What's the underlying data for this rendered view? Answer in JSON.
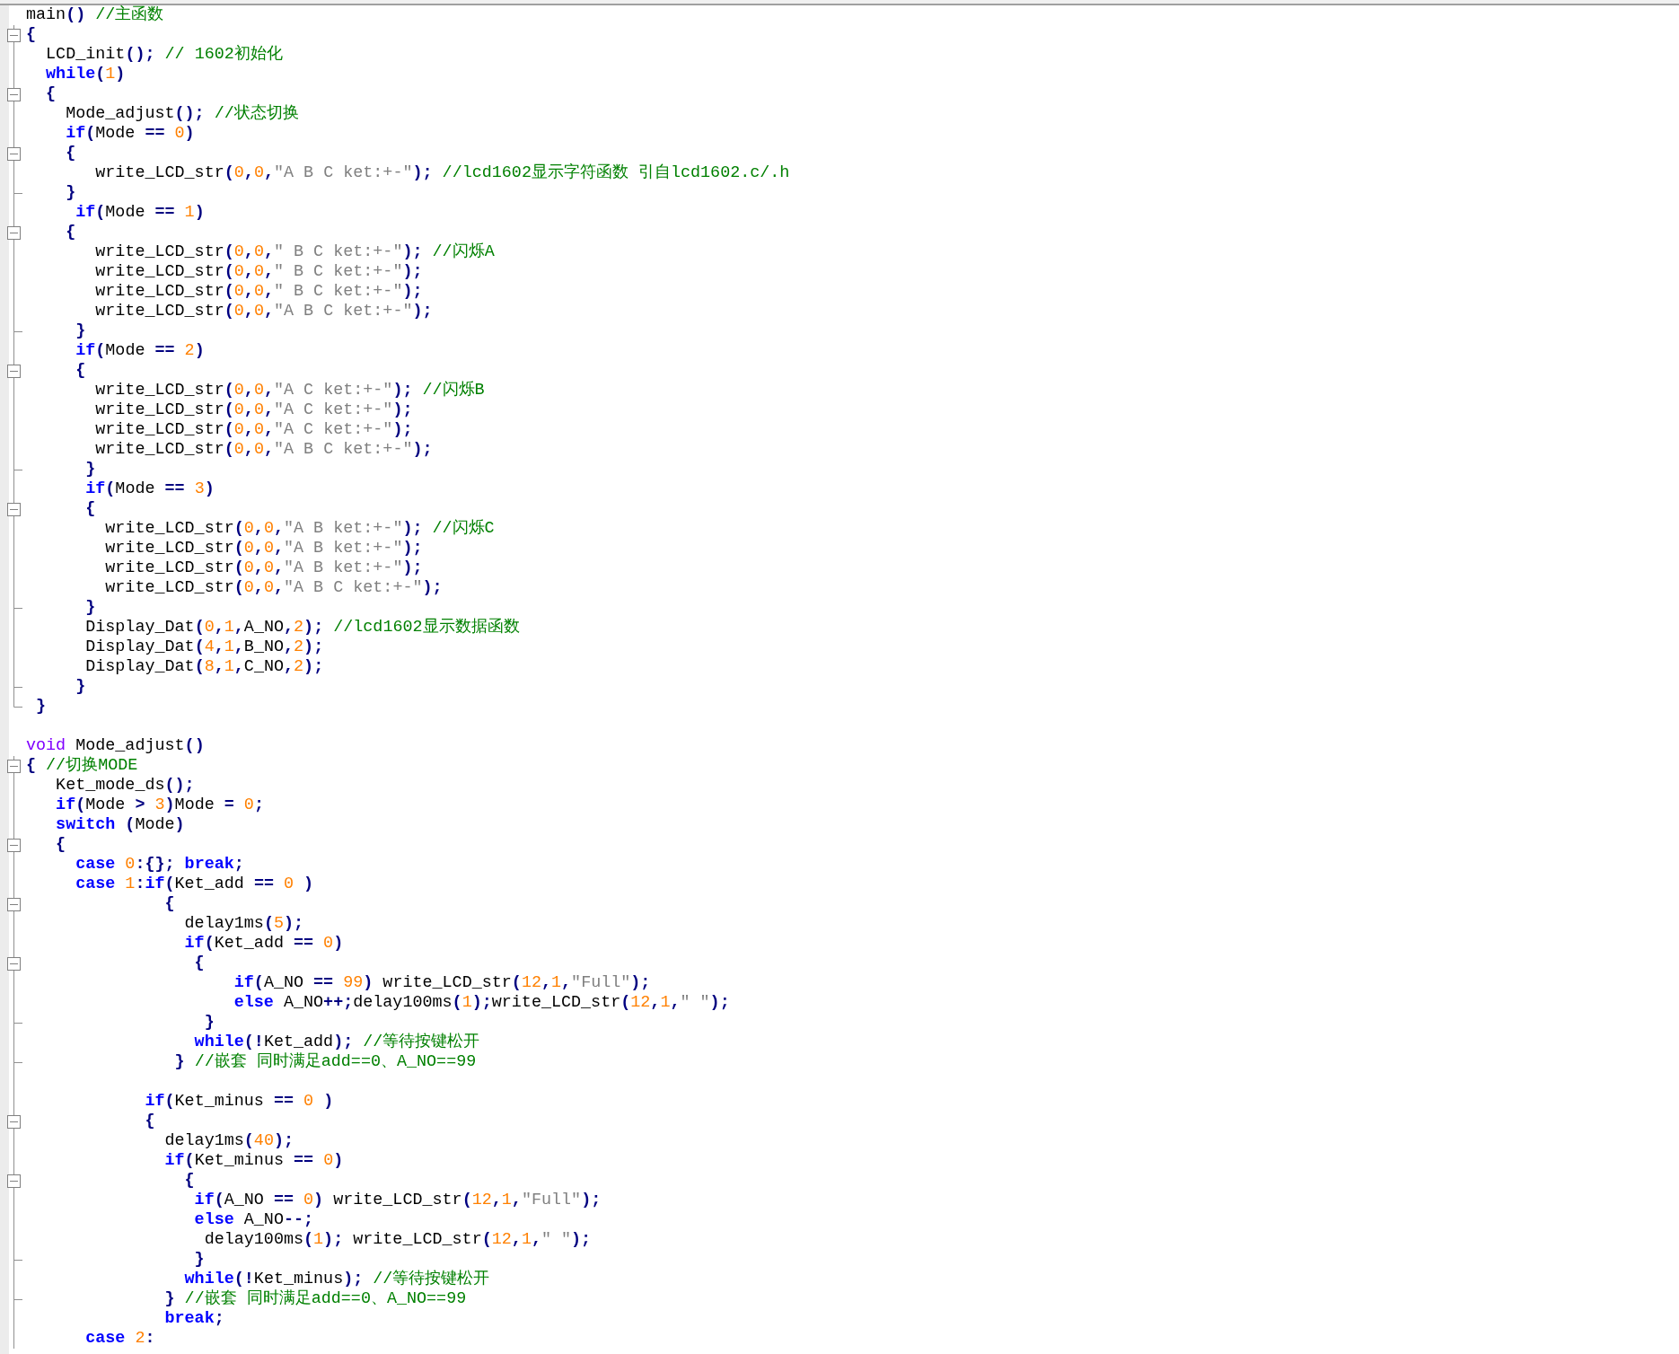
{
  "editor": {
    "lines": [
      {
        "kind": "code",
        "fold_start": false,
        "fold_end": false,
        "in_block": false,
        "tokens": [
          {
            "kind": "id",
            "text": "main"
          },
          {
            "kind": "op",
            "text": "() "
          },
          {
            "kind": "cmt",
            "text": "//主函数"
          }
        ]
      },
      {
        "kind": "code",
        "fold_start": true,
        "fold_end": false,
        "in_block": true,
        "tokens": [
          {
            "kind": "op",
            "text": "{"
          }
        ]
      },
      {
        "kind": "code",
        "fold_start": false,
        "fold_end": false,
        "in_block": true,
        "tokens": [
          {
            "kind": "id",
            "text": "  LCD_init"
          },
          {
            "kind": "op",
            "text": "(); "
          },
          {
            "kind": "cmt",
            "text": "// 1602初始化"
          }
        ]
      },
      {
        "kind": "code",
        "fold_start": false,
        "fold_end": false,
        "in_block": true,
        "tokens": [
          {
            "kind": "kw",
            "text": "  while"
          },
          {
            "kind": "op",
            "text": "("
          },
          {
            "kind": "num",
            "text": "1"
          },
          {
            "kind": "op",
            "text": ")"
          }
        ]
      },
      {
        "kind": "code",
        "fold_start": true,
        "fold_end": false,
        "in_block": true,
        "tokens": [
          {
            "kind": "op",
            "text": "  {"
          }
        ]
      },
      {
        "kind": "code",
        "fold_start": false,
        "fold_end": false,
        "in_block": true,
        "tokens": [
          {
            "kind": "id",
            "text": "    Mode_adjust"
          },
          {
            "kind": "op",
            "text": "(); "
          },
          {
            "kind": "cmt",
            "text": "//状态切换"
          }
        ]
      },
      {
        "kind": "code",
        "fold_start": false,
        "fold_end": false,
        "in_block": true,
        "tokens": [
          {
            "kind": "kw",
            "text": "    if"
          },
          {
            "kind": "op",
            "text": "("
          },
          {
            "kind": "id",
            "text": "Mode "
          },
          {
            "kind": "op",
            "text": "== "
          },
          {
            "kind": "num",
            "text": "0"
          },
          {
            "kind": "op",
            "text": ")"
          }
        ]
      },
      {
        "kind": "code",
        "fold_start": true,
        "fold_end": false,
        "in_block": true,
        "tokens": [
          {
            "kind": "op",
            "text": "    {"
          }
        ]
      },
      {
        "kind": "code",
        "fold_start": false,
        "fold_end": false,
        "in_block": true,
        "tokens": [
          {
            "kind": "id",
            "text": "       write_LCD_str"
          },
          {
            "kind": "op",
            "text": "("
          },
          {
            "kind": "num",
            "text": "0"
          },
          {
            "kind": "op",
            "text": ","
          },
          {
            "kind": "num",
            "text": "0"
          },
          {
            "kind": "op",
            "text": ","
          },
          {
            "kind": "str",
            "text": "\"A B C ket:+-\""
          },
          {
            "kind": "op",
            "text": "); "
          },
          {
            "kind": "cmt",
            "text": "//lcd1602显示字符函数 引自lcd1602.c/.h"
          }
        ]
      },
      {
        "kind": "code",
        "fold_start": false,
        "fold_end": true,
        "in_block": true,
        "tokens": [
          {
            "kind": "op",
            "text": "    }"
          }
        ]
      },
      {
        "kind": "code",
        "fold_start": false,
        "fold_end": false,
        "in_block": true,
        "tokens": [
          {
            "kind": "kw",
            "text": "     if"
          },
          {
            "kind": "op",
            "text": "("
          },
          {
            "kind": "id",
            "text": "Mode "
          },
          {
            "kind": "op",
            "text": "== "
          },
          {
            "kind": "num",
            "text": "1"
          },
          {
            "kind": "op",
            "text": ")"
          }
        ]
      },
      {
        "kind": "code",
        "fold_start": true,
        "fold_end": false,
        "in_block": true,
        "tokens": [
          {
            "kind": "op",
            "text": "    {"
          }
        ]
      },
      {
        "kind": "code",
        "fold_start": false,
        "fold_end": false,
        "in_block": true,
        "tokens": [
          {
            "kind": "id",
            "text": "       write_LCD_str"
          },
          {
            "kind": "op",
            "text": "("
          },
          {
            "kind": "num",
            "text": "0"
          },
          {
            "kind": "op",
            "text": ","
          },
          {
            "kind": "num",
            "text": "0"
          },
          {
            "kind": "op",
            "text": ","
          },
          {
            "kind": "str",
            "text": "\" B C ket:+-\""
          },
          {
            "kind": "op",
            "text": "); "
          },
          {
            "kind": "cmt",
            "text": "//闪烁A"
          }
        ]
      },
      {
        "kind": "code",
        "fold_start": false,
        "fold_end": false,
        "in_block": true,
        "tokens": [
          {
            "kind": "id",
            "text": "       write_LCD_str"
          },
          {
            "kind": "op",
            "text": "("
          },
          {
            "kind": "num",
            "text": "0"
          },
          {
            "kind": "op",
            "text": ","
          },
          {
            "kind": "num",
            "text": "0"
          },
          {
            "kind": "op",
            "text": ","
          },
          {
            "kind": "str",
            "text": "\" B C ket:+-\""
          },
          {
            "kind": "op",
            "text": ");"
          }
        ]
      },
      {
        "kind": "code",
        "fold_start": false,
        "fold_end": false,
        "in_block": true,
        "tokens": [
          {
            "kind": "id",
            "text": "       write_LCD_str"
          },
          {
            "kind": "op",
            "text": "("
          },
          {
            "kind": "num",
            "text": "0"
          },
          {
            "kind": "op",
            "text": ","
          },
          {
            "kind": "num",
            "text": "0"
          },
          {
            "kind": "op",
            "text": ","
          },
          {
            "kind": "str",
            "text": "\" B C ket:+-\""
          },
          {
            "kind": "op",
            "text": ");"
          }
        ]
      },
      {
        "kind": "code",
        "fold_start": false,
        "fold_end": false,
        "in_block": true,
        "tokens": [
          {
            "kind": "id",
            "text": "       write_LCD_str"
          },
          {
            "kind": "op",
            "text": "("
          },
          {
            "kind": "num",
            "text": "0"
          },
          {
            "kind": "op",
            "text": ","
          },
          {
            "kind": "num",
            "text": "0"
          },
          {
            "kind": "op",
            "text": ","
          },
          {
            "kind": "str",
            "text": "\"A B C ket:+-\""
          },
          {
            "kind": "op",
            "text": ");"
          }
        ]
      },
      {
        "kind": "code",
        "fold_start": false,
        "fold_end": true,
        "in_block": true,
        "tokens": [
          {
            "kind": "op",
            "text": "     }"
          }
        ]
      },
      {
        "kind": "code",
        "fold_start": false,
        "fold_end": false,
        "in_block": true,
        "tokens": [
          {
            "kind": "kw",
            "text": "     if"
          },
          {
            "kind": "op",
            "text": "("
          },
          {
            "kind": "id",
            "text": "Mode "
          },
          {
            "kind": "op",
            "text": "== "
          },
          {
            "kind": "num",
            "text": "2"
          },
          {
            "kind": "op",
            "text": ")"
          }
        ]
      },
      {
        "kind": "code",
        "fold_start": true,
        "fold_end": false,
        "in_block": true,
        "tokens": [
          {
            "kind": "op",
            "text": "     {"
          }
        ]
      },
      {
        "kind": "code",
        "fold_start": false,
        "fold_end": false,
        "in_block": true,
        "tokens": [
          {
            "kind": "id",
            "text": "       write_LCD_str"
          },
          {
            "kind": "op",
            "text": "("
          },
          {
            "kind": "num",
            "text": "0"
          },
          {
            "kind": "op",
            "text": ","
          },
          {
            "kind": "num",
            "text": "0"
          },
          {
            "kind": "op",
            "text": ","
          },
          {
            "kind": "str",
            "text": "\"A C ket:+-\""
          },
          {
            "kind": "op",
            "text": "); "
          },
          {
            "kind": "cmt",
            "text": "//闪烁B"
          }
        ]
      },
      {
        "kind": "code",
        "fold_start": false,
        "fold_end": false,
        "in_block": true,
        "tokens": [
          {
            "kind": "id",
            "text": "       write_LCD_str"
          },
          {
            "kind": "op",
            "text": "("
          },
          {
            "kind": "num",
            "text": "0"
          },
          {
            "kind": "op",
            "text": ","
          },
          {
            "kind": "num",
            "text": "0"
          },
          {
            "kind": "op",
            "text": ","
          },
          {
            "kind": "str",
            "text": "\"A C ket:+-\""
          },
          {
            "kind": "op",
            "text": ");"
          }
        ]
      },
      {
        "kind": "code",
        "fold_start": false,
        "fold_end": false,
        "in_block": true,
        "tokens": [
          {
            "kind": "id",
            "text": "       write_LCD_str"
          },
          {
            "kind": "op",
            "text": "("
          },
          {
            "kind": "num",
            "text": "0"
          },
          {
            "kind": "op",
            "text": ","
          },
          {
            "kind": "num",
            "text": "0"
          },
          {
            "kind": "op",
            "text": ","
          },
          {
            "kind": "str",
            "text": "\"A C ket:+-\""
          },
          {
            "kind": "op",
            "text": ");"
          }
        ]
      },
      {
        "kind": "code",
        "fold_start": false,
        "fold_end": false,
        "in_block": true,
        "tokens": [
          {
            "kind": "id",
            "text": "       write_LCD_str"
          },
          {
            "kind": "op",
            "text": "("
          },
          {
            "kind": "num",
            "text": "0"
          },
          {
            "kind": "op",
            "text": ","
          },
          {
            "kind": "num",
            "text": "0"
          },
          {
            "kind": "op",
            "text": ","
          },
          {
            "kind": "str",
            "text": "\"A B C ket:+-\""
          },
          {
            "kind": "op",
            "text": ");"
          }
        ]
      },
      {
        "kind": "code",
        "fold_start": false,
        "fold_end": true,
        "in_block": true,
        "tokens": [
          {
            "kind": "op",
            "text": "      }"
          }
        ]
      },
      {
        "kind": "code",
        "fold_start": false,
        "fold_end": false,
        "in_block": true,
        "tokens": [
          {
            "kind": "kw",
            "text": "      if"
          },
          {
            "kind": "op",
            "text": "("
          },
          {
            "kind": "id",
            "text": "Mode "
          },
          {
            "kind": "op",
            "text": "== "
          },
          {
            "kind": "num",
            "text": "3"
          },
          {
            "kind": "op",
            "text": ")"
          }
        ]
      },
      {
        "kind": "code",
        "fold_start": true,
        "fold_end": false,
        "in_block": true,
        "tokens": [
          {
            "kind": "op",
            "text": "      {"
          }
        ]
      },
      {
        "kind": "code",
        "fold_start": false,
        "fold_end": false,
        "in_block": true,
        "tokens": [
          {
            "kind": "id",
            "text": "        write_LCD_str"
          },
          {
            "kind": "op",
            "text": "("
          },
          {
            "kind": "num",
            "text": "0"
          },
          {
            "kind": "op",
            "text": ","
          },
          {
            "kind": "num",
            "text": "0"
          },
          {
            "kind": "op",
            "text": ","
          },
          {
            "kind": "str",
            "text": "\"A B ket:+-\""
          },
          {
            "kind": "op",
            "text": "); "
          },
          {
            "kind": "cmt",
            "text": "//闪烁C"
          }
        ]
      },
      {
        "kind": "code",
        "fold_start": false,
        "fold_end": false,
        "in_block": true,
        "tokens": [
          {
            "kind": "id",
            "text": "        write_LCD_str"
          },
          {
            "kind": "op",
            "text": "("
          },
          {
            "kind": "num",
            "text": "0"
          },
          {
            "kind": "op",
            "text": ","
          },
          {
            "kind": "num",
            "text": "0"
          },
          {
            "kind": "op",
            "text": ","
          },
          {
            "kind": "str",
            "text": "\"A B ket:+-\""
          },
          {
            "kind": "op",
            "text": ");"
          }
        ]
      },
      {
        "kind": "code",
        "fold_start": false,
        "fold_end": false,
        "in_block": true,
        "tokens": [
          {
            "kind": "id",
            "text": "        write_LCD_str"
          },
          {
            "kind": "op",
            "text": "("
          },
          {
            "kind": "num",
            "text": "0"
          },
          {
            "kind": "op",
            "text": ","
          },
          {
            "kind": "num",
            "text": "0"
          },
          {
            "kind": "op",
            "text": ","
          },
          {
            "kind": "str",
            "text": "\"A B ket:+-\""
          },
          {
            "kind": "op",
            "text": ");"
          }
        ]
      },
      {
        "kind": "code",
        "fold_start": false,
        "fold_end": false,
        "in_block": true,
        "tokens": [
          {
            "kind": "id",
            "text": "        write_LCD_str"
          },
          {
            "kind": "op",
            "text": "("
          },
          {
            "kind": "num",
            "text": "0"
          },
          {
            "kind": "op",
            "text": ","
          },
          {
            "kind": "num",
            "text": "0"
          },
          {
            "kind": "op",
            "text": ","
          },
          {
            "kind": "str",
            "text": "\"A B C ket:+-\""
          },
          {
            "kind": "op",
            "text": ");"
          }
        ]
      },
      {
        "kind": "code",
        "fold_start": false,
        "fold_end": true,
        "in_block": true,
        "tokens": [
          {
            "kind": "op",
            "text": "      }"
          }
        ]
      },
      {
        "kind": "code",
        "fold_start": false,
        "fold_end": false,
        "in_block": true,
        "tokens": [
          {
            "kind": "id",
            "text": "      Display_Dat"
          },
          {
            "kind": "op",
            "text": "("
          },
          {
            "kind": "num",
            "text": "0"
          },
          {
            "kind": "op",
            "text": ","
          },
          {
            "kind": "num",
            "text": "1"
          },
          {
            "kind": "op",
            "text": ","
          },
          {
            "kind": "id",
            "text": "A_NO"
          },
          {
            "kind": "op",
            "text": ","
          },
          {
            "kind": "num",
            "text": "2"
          },
          {
            "kind": "op",
            "text": "); "
          },
          {
            "kind": "cmt",
            "text": "//lcd1602显示数据函数"
          }
        ]
      },
      {
        "kind": "code",
        "fold_start": false,
        "fold_end": false,
        "in_block": true,
        "tokens": [
          {
            "kind": "id",
            "text": "      Display_Dat"
          },
          {
            "kind": "op",
            "text": "("
          },
          {
            "kind": "num",
            "text": "4"
          },
          {
            "kind": "op",
            "text": ","
          },
          {
            "kind": "num",
            "text": "1"
          },
          {
            "kind": "op",
            "text": ","
          },
          {
            "kind": "id",
            "text": "B_NO"
          },
          {
            "kind": "op",
            "text": ","
          },
          {
            "kind": "num",
            "text": "2"
          },
          {
            "kind": "op",
            "text": ");"
          }
        ]
      },
      {
        "kind": "code",
        "fold_start": false,
        "fold_end": false,
        "in_block": true,
        "tokens": [
          {
            "kind": "id",
            "text": "      Display_Dat"
          },
          {
            "kind": "op",
            "text": "("
          },
          {
            "kind": "num",
            "text": "8"
          },
          {
            "kind": "op",
            "text": ","
          },
          {
            "kind": "num",
            "text": "1"
          },
          {
            "kind": "op",
            "text": ","
          },
          {
            "kind": "id",
            "text": "C_NO"
          },
          {
            "kind": "op",
            "text": ","
          },
          {
            "kind": "num",
            "text": "2"
          },
          {
            "kind": "op",
            "text": ");"
          }
        ]
      },
      {
        "kind": "code",
        "fold_start": false,
        "fold_end": true,
        "in_block": true,
        "tokens": [
          {
            "kind": "op",
            "text": "     }"
          }
        ]
      },
      {
        "kind": "code",
        "fold_start": false,
        "fold_end": true,
        "in_block": false,
        "tokens": [
          {
            "kind": "op",
            "text": " }"
          }
        ]
      },
      {
        "kind": "blank",
        "fold_start": false,
        "fold_end": false,
        "in_block": false
      },
      {
        "kind": "code",
        "fold_start": false,
        "fold_end": false,
        "in_block": false,
        "tokens": [
          {
            "kind": "type",
            "text": "void"
          },
          {
            "kind": "id",
            "text": " Mode_adjust"
          },
          {
            "kind": "op",
            "text": "()"
          }
        ]
      },
      {
        "kind": "code",
        "fold_start": true,
        "fold_end": false,
        "in_block": true,
        "tokens": [
          {
            "kind": "op",
            "text": "{ "
          },
          {
            "kind": "cmt",
            "text": "//切换MODE"
          }
        ]
      },
      {
        "kind": "code",
        "fold_start": false,
        "fold_end": false,
        "in_block": true,
        "tokens": [
          {
            "kind": "id",
            "text": "   Ket_mode_ds"
          },
          {
            "kind": "op",
            "text": "();"
          }
        ]
      },
      {
        "kind": "code",
        "fold_start": false,
        "fold_end": false,
        "in_block": true,
        "tokens": [
          {
            "kind": "kw",
            "text": "   if"
          },
          {
            "kind": "op",
            "text": "("
          },
          {
            "kind": "id",
            "text": "Mode "
          },
          {
            "kind": "op",
            "text": "> "
          },
          {
            "kind": "num",
            "text": "3"
          },
          {
            "kind": "op",
            "text": ")"
          },
          {
            "kind": "id",
            "text": "Mode "
          },
          {
            "kind": "op",
            "text": "= "
          },
          {
            "kind": "num",
            "text": "0"
          },
          {
            "kind": "op",
            "text": ";"
          }
        ]
      },
      {
        "kind": "code",
        "fold_start": false,
        "fold_end": false,
        "in_block": true,
        "tokens": [
          {
            "kind": "kw",
            "text": "   switch"
          },
          {
            "kind": "op",
            "text": " ("
          },
          {
            "kind": "id",
            "text": "Mode"
          },
          {
            "kind": "op",
            "text": ")"
          }
        ]
      },
      {
        "kind": "code",
        "fold_start": true,
        "fold_end": false,
        "in_block": true,
        "tokens": [
          {
            "kind": "op",
            "text": "   {"
          }
        ]
      },
      {
        "kind": "code",
        "fold_start": false,
        "fold_end": false,
        "in_block": true,
        "tokens": [
          {
            "kind": "kw",
            "text": "     case"
          },
          {
            "kind": "num",
            "text": " 0"
          },
          {
            "kind": "op",
            "text": ":{}; "
          },
          {
            "kind": "kw",
            "text": "break"
          },
          {
            "kind": "op",
            "text": ";"
          }
        ]
      },
      {
        "kind": "code",
        "fold_start": false,
        "fold_end": false,
        "in_block": true,
        "tokens": [
          {
            "kind": "kw",
            "text": "     case"
          },
          {
            "kind": "num",
            "text": " 1"
          },
          {
            "kind": "op",
            "text": ":"
          },
          {
            "kind": "kw",
            "text": "if"
          },
          {
            "kind": "op",
            "text": "("
          },
          {
            "kind": "id",
            "text": "Ket_add "
          },
          {
            "kind": "op",
            "text": "== "
          },
          {
            "kind": "num",
            "text": "0"
          },
          {
            "kind": "op",
            "text": " )"
          }
        ]
      },
      {
        "kind": "code",
        "fold_start": true,
        "fold_end": false,
        "in_block": true,
        "tokens": [
          {
            "kind": "op",
            "text": "              {"
          }
        ]
      },
      {
        "kind": "code",
        "fold_start": false,
        "fold_end": false,
        "in_block": true,
        "tokens": [
          {
            "kind": "id",
            "text": "                delay1ms"
          },
          {
            "kind": "op",
            "text": "("
          },
          {
            "kind": "num",
            "text": "5"
          },
          {
            "kind": "op",
            "text": ");"
          }
        ]
      },
      {
        "kind": "code",
        "fold_start": false,
        "fold_end": false,
        "in_block": true,
        "tokens": [
          {
            "kind": "kw",
            "text": "                if"
          },
          {
            "kind": "op",
            "text": "("
          },
          {
            "kind": "id",
            "text": "Ket_add "
          },
          {
            "kind": "op",
            "text": "== "
          },
          {
            "kind": "num",
            "text": "0"
          },
          {
            "kind": "op",
            "text": ")"
          }
        ]
      },
      {
        "kind": "code",
        "fold_start": true,
        "fold_end": false,
        "in_block": true,
        "tokens": [
          {
            "kind": "op",
            "text": "                 {"
          }
        ]
      },
      {
        "kind": "code",
        "fold_start": false,
        "fold_end": false,
        "in_block": true,
        "tokens": [
          {
            "kind": "kw",
            "text": "                     if"
          },
          {
            "kind": "op",
            "text": "("
          },
          {
            "kind": "id",
            "text": "A_NO "
          },
          {
            "kind": "op",
            "text": "== "
          },
          {
            "kind": "num",
            "text": "99"
          },
          {
            "kind": "op",
            "text": ") "
          },
          {
            "kind": "id",
            "text": "write_LCD_str"
          },
          {
            "kind": "op",
            "text": "("
          },
          {
            "kind": "num",
            "text": "12"
          },
          {
            "kind": "op",
            "text": ","
          },
          {
            "kind": "num",
            "text": "1"
          },
          {
            "kind": "op",
            "text": ","
          },
          {
            "kind": "str",
            "text": "\"Full\""
          },
          {
            "kind": "op",
            "text": ");"
          }
        ]
      },
      {
        "kind": "code",
        "fold_start": false,
        "fold_end": false,
        "in_block": true,
        "tokens": [
          {
            "kind": "kw",
            "text": "                     else"
          },
          {
            "kind": "id",
            "text": " A_NO"
          },
          {
            "kind": "op",
            "text": "++;"
          },
          {
            "kind": "id",
            "text": "delay100ms"
          },
          {
            "kind": "op",
            "text": "("
          },
          {
            "kind": "num",
            "text": "1"
          },
          {
            "kind": "op",
            "text": ");"
          },
          {
            "kind": "id",
            "text": "write_LCD_str"
          },
          {
            "kind": "op",
            "text": "("
          },
          {
            "kind": "num",
            "text": "12"
          },
          {
            "kind": "op",
            "text": ","
          },
          {
            "kind": "num",
            "text": "1"
          },
          {
            "kind": "op",
            "text": ","
          },
          {
            "kind": "str",
            "text": "\" \""
          },
          {
            "kind": "op",
            "text": ");"
          }
        ]
      },
      {
        "kind": "code",
        "fold_start": false,
        "fold_end": true,
        "in_block": true,
        "tokens": [
          {
            "kind": "op",
            "text": "                  }"
          }
        ]
      },
      {
        "kind": "code",
        "fold_start": false,
        "fold_end": false,
        "in_block": true,
        "tokens": [
          {
            "kind": "kw",
            "text": "                 while"
          },
          {
            "kind": "op",
            "text": "(!"
          },
          {
            "kind": "id",
            "text": "Ket_add"
          },
          {
            "kind": "op",
            "text": "); "
          },
          {
            "kind": "cmt",
            "text": "//等待按键松开"
          }
        ]
      },
      {
        "kind": "code",
        "fold_start": false,
        "fold_end": true,
        "in_block": true,
        "tokens": [
          {
            "kind": "op",
            "text": "               } "
          },
          {
            "kind": "cmt",
            "text": "//嵌套 同时满足add==0、A_NO==99"
          }
        ]
      },
      {
        "kind": "blank",
        "fold_start": false,
        "fold_end": false,
        "in_block": true
      },
      {
        "kind": "code",
        "fold_start": false,
        "fold_end": false,
        "in_block": true,
        "tokens": [
          {
            "kind": "kw",
            "text": "            if"
          },
          {
            "kind": "op",
            "text": "("
          },
          {
            "kind": "id",
            "text": "Ket_minus "
          },
          {
            "kind": "op",
            "text": "== "
          },
          {
            "kind": "num",
            "text": "0"
          },
          {
            "kind": "op",
            "text": " )"
          }
        ]
      },
      {
        "kind": "code",
        "fold_start": true,
        "fold_end": false,
        "in_block": true,
        "tokens": [
          {
            "kind": "op",
            "text": "            {"
          }
        ]
      },
      {
        "kind": "code",
        "fold_start": false,
        "fold_end": false,
        "in_block": true,
        "tokens": [
          {
            "kind": "id",
            "text": "              delay1ms"
          },
          {
            "kind": "op",
            "text": "("
          },
          {
            "kind": "num",
            "text": "40"
          },
          {
            "kind": "op",
            "text": ");"
          }
        ]
      },
      {
        "kind": "code",
        "fold_start": false,
        "fold_end": false,
        "in_block": true,
        "tokens": [
          {
            "kind": "kw",
            "text": "              if"
          },
          {
            "kind": "op",
            "text": "("
          },
          {
            "kind": "id",
            "text": "Ket_minus "
          },
          {
            "kind": "op",
            "text": "== "
          },
          {
            "kind": "num",
            "text": "0"
          },
          {
            "kind": "op",
            "text": ")"
          }
        ]
      },
      {
        "kind": "code",
        "fold_start": true,
        "fold_end": false,
        "in_block": true,
        "tokens": [
          {
            "kind": "op",
            "text": "                {"
          }
        ]
      },
      {
        "kind": "code",
        "fold_start": false,
        "fold_end": false,
        "in_block": true,
        "tokens": [
          {
            "kind": "kw",
            "text": "                 if"
          },
          {
            "kind": "op",
            "text": "("
          },
          {
            "kind": "id",
            "text": "A_NO "
          },
          {
            "kind": "op",
            "text": "== "
          },
          {
            "kind": "num",
            "text": "0"
          },
          {
            "kind": "op",
            "text": ") "
          },
          {
            "kind": "id",
            "text": "write_LCD_str"
          },
          {
            "kind": "op",
            "text": "("
          },
          {
            "kind": "num",
            "text": "12"
          },
          {
            "kind": "op",
            "text": ","
          },
          {
            "kind": "num",
            "text": "1"
          },
          {
            "kind": "op",
            "text": ","
          },
          {
            "kind": "str",
            "text": "\"Full\""
          },
          {
            "kind": "op",
            "text": ");"
          }
        ]
      },
      {
        "kind": "code",
        "fold_start": false,
        "fold_end": false,
        "in_block": true,
        "tokens": [
          {
            "kind": "kw",
            "text": "                 else"
          },
          {
            "kind": "id",
            "text": " A_NO"
          },
          {
            "kind": "op",
            "text": "--;"
          }
        ]
      },
      {
        "kind": "code",
        "fold_start": false,
        "fold_end": false,
        "in_block": true,
        "tokens": [
          {
            "kind": "id",
            "text": "                  delay100ms"
          },
          {
            "kind": "op",
            "text": "("
          },
          {
            "kind": "num",
            "text": "1"
          },
          {
            "kind": "op",
            "text": "); "
          },
          {
            "kind": "id",
            "text": "write_LCD_str"
          },
          {
            "kind": "op",
            "text": "("
          },
          {
            "kind": "num",
            "text": "12"
          },
          {
            "kind": "op",
            "text": ","
          },
          {
            "kind": "num",
            "text": "1"
          },
          {
            "kind": "op",
            "text": ","
          },
          {
            "kind": "str",
            "text": "\" \""
          },
          {
            "kind": "op",
            "text": ");"
          }
        ]
      },
      {
        "kind": "code",
        "fold_start": false,
        "fold_end": true,
        "in_block": true,
        "tokens": [
          {
            "kind": "op",
            "text": "                 }"
          }
        ]
      },
      {
        "kind": "code",
        "fold_start": false,
        "fold_end": false,
        "in_block": true,
        "tokens": [
          {
            "kind": "kw",
            "text": "                while"
          },
          {
            "kind": "op",
            "text": "(!"
          },
          {
            "kind": "id",
            "text": "Ket_minus"
          },
          {
            "kind": "op",
            "text": "); "
          },
          {
            "kind": "cmt",
            "text": "//等待按键松开"
          }
        ]
      },
      {
        "kind": "code",
        "fold_start": false,
        "fold_end": true,
        "in_block": true,
        "tokens": [
          {
            "kind": "op",
            "text": "              } "
          },
          {
            "kind": "cmt",
            "text": "//嵌套 同时满足add==0、A_NO==99"
          }
        ]
      },
      {
        "kind": "code",
        "fold_start": false,
        "fold_end": false,
        "in_block": true,
        "tokens": [
          {
            "kind": "kw",
            "text": "              break"
          },
          {
            "kind": "op",
            "text": ";"
          }
        ]
      },
      {
        "kind": "code",
        "fold_start": false,
        "fold_end": false,
        "in_block": true,
        "tokens": [
          {
            "kind": "kw",
            "text": "      case"
          },
          {
            "kind": "num",
            "text": " 2"
          },
          {
            "kind": "op",
            "text": ":"
          }
        ]
      }
    ]
  }
}
